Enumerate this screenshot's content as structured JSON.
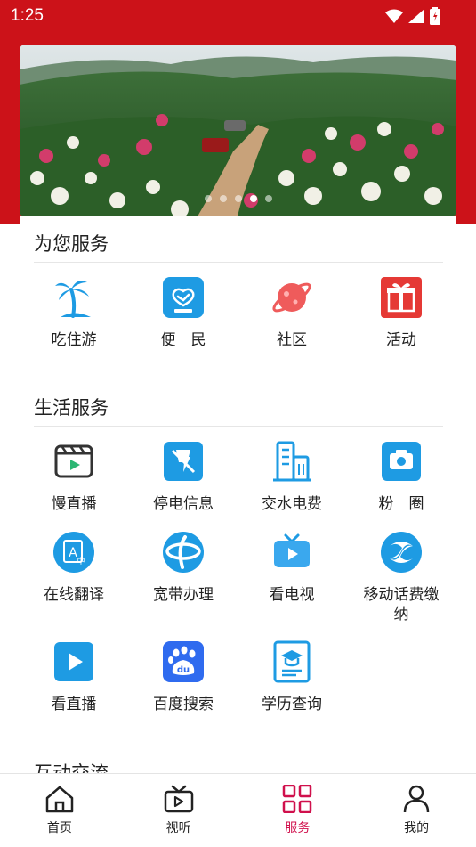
{
  "status_bar": {
    "time": "1:25"
  },
  "banner": {
    "slide_count": 5,
    "active_slide": 3
  },
  "sections": {
    "service": {
      "title": "为您服务",
      "items": [
        {
          "label": "吃住游",
          "icon": "palm-tree-icon"
        },
        {
          "label": "便　民",
          "icon": "handshake-icon"
        },
        {
          "label": "社区",
          "icon": "planet-icon"
        },
        {
          "label": "活动",
          "icon": "gift-icon"
        }
      ]
    },
    "life": {
      "title": "生活服务",
      "items": [
        {
          "label": "慢直播",
          "icon": "video-clapper-icon"
        },
        {
          "label": "停电信息",
          "icon": "power-off-icon"
        },
        {
          "label": "交水电费",
          "icon": "building-icon"
        },
        {
          "label": "粉　圈",
          "icon": "camera-icon"
        },
        {
          "label": "在线翻译",
          "icon": "translate-icon"
        },
        {
          "label": "宽带办理",
          "icon": "telecom-icon"
        },
        {
          "label": "看电视",
          "icon": "tv-icon"
        },
        {
          "label": "移动话费缴纳",
          "icon": "china-mobile-icon"
        },
        {
          "label": "看直播",
          "icon": "live-play-icon"
        },
        {
          "label": "百度搜索",
          "icon": "baidu-icon"
        },
        {
          "label": "学历查询",
          "icon": "graduation-cap-icon"
        }
      ]
    },
    "interact": {
      "title": "互动交流"
    }
  },
  "tabbar": {
    "tabs": [
      {
        "label": "首页",
        "icon": "home-icon"
      },
      {
        "label": "视听",
        "icon": "media-icon"
      },
      {
        "label": "服务",
        "icon": "grid-icon"
      },
      {
        "label": "我的",
        "icon": "user-icon"
      }
    ],
    "active": "服务"
  },
  "colors": {
    "brand_red": "#cc1219",
    "active_tab": "#d0104c",
    "icon_blue": "#1e9be3"
  }
}
